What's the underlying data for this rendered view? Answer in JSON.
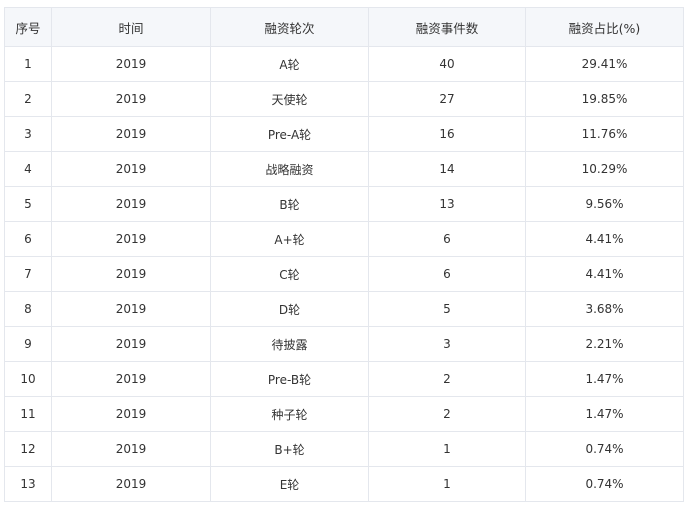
{
  "table": {
    "headers": [
      "序号",
      "时间",
      "融资轮次",
      "融资事件数",
      "融资占比(%)"
    ],
    "rows": [
      [
        "1",
        "2019",
        "A轮",
        "40",
        "29.41%"
      ],
      [
        "2",
        "2019",
        "天使轮",
        "27",
        "19.85%"
      ],
      [
        "3",
        "2019",
        "Pre-A轮",
        "16",
        "11.76%"
      ],
      [
        "4",
        "2019",
        "战略融资",
        "14",
        "10.29%"
      ],
      [
        "5",
        "2019",
        "B轮",
        "13",
        "9.56%"
      ],
      [
        "6",
        "2019",
        "A+轮",
        "6",
        "4.41%"
      ],
      [
        "7",
        "2019",
        "C轮",
        "6",
        "4.41%"
      ],
      [
        "8",
        "2019",
        "D轮",
        "5",
        "3.68%"
      ],
      [
        "9",
        "2019",
        "待披露",
        "3",
        "2.21%"
      ],
      [
        "10",
        "2019",
        "Pre-B轮",
        "2",
        "1.47%"
      ],
      [
        "11",
        "2019",
        "种子轮",
        "2",
        "1.47%"
      ],
      [
        "12",
        "2019",
        "B+轮",
        "1",
        "0.74%"
      ],
      [
        "13",
        "2019",
        "E轮",
        "1",
        "0.74%"
      ]
    ]
  }
}
